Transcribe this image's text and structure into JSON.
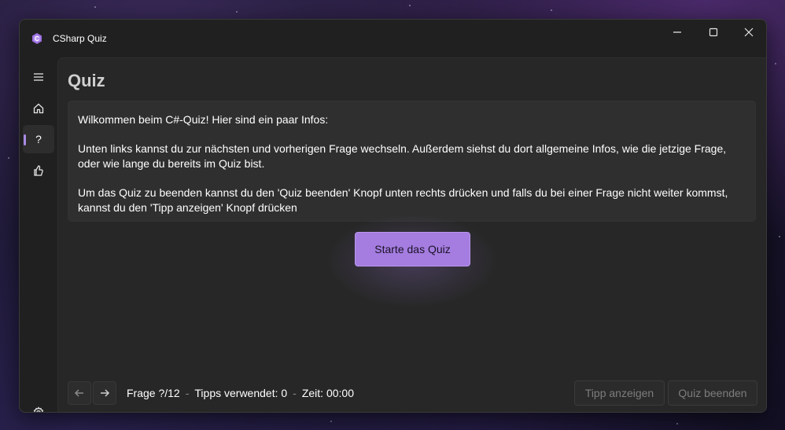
{
  "window": {
    "title": "CSharp Quiz",
    "accent_color": "#a57de0"
  },
  "sidebar": {
    "items": [
      {
        "name": "menu",
        "icon": "hamburger-icon"
      },
      {
        "name": "home",
        "icon": "home-icon"
      },
      {
        "name": "quiz",
        "icon": "question-icon",
        "label": "?",
        "active": true
      },
      {
        "name": "tips",
        "icon": "thumbs-up-icon"
      }
    ],
    "settings_icon": "gear-icon"
  },
  "main": {
    "title": "Quiz",
    "info": {
      "line1": "Wilkommen beim C#-Quiz! Hier sind ein paar Infos:",
      "line2": "Unten links kannst du zur nächsten und vorherigen Frage wechseln. Außerdem siehst du dort allgemeine Infos, wie die jetzige Frage, oder wie lange du bereits im Quiz bist.",
      "line3": "Um das Quiz zu beenden kannst du den 'Quiz beenden' Knopf unten rechts drücken und falls du bei einer Frage nicht weiter kommst, kannst du den 'Tipp anzeigen' Knopf drücken"
    },
    "start_button": "Starte das Quiz"
  },
  "footer": {
    "question": "Frage ?/12",
    "separator": "-",
    "tips_used": "Tipps verwendet: 0",
    "time": "Zeit: 00:00",
    "tip_button": "Tipp anzeigen",
    "end_button": "Quiz beenden"
  }
}
